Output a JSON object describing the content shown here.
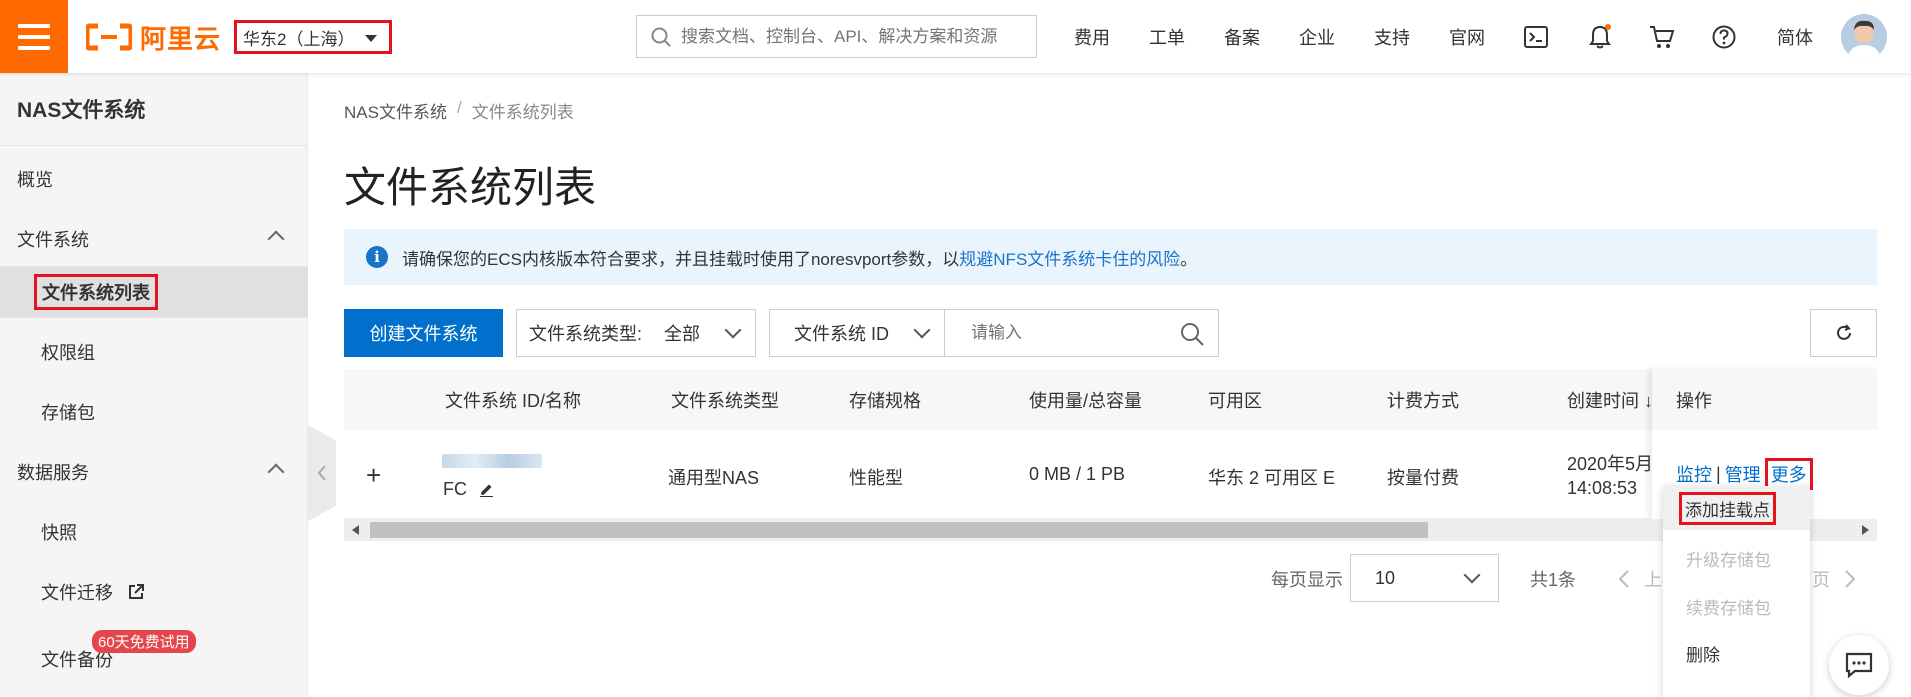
{
  "header": {
    "logo_text": "阿里云",
    "region": "华东2（上海）",
    "search_placeholder": "搜索文档、控制台、API、解决方案和资源",
    "nav": [
      "费用",
      "工单",
      "备案",
      "企业",
      "支持",
      "官网"
    ],
    "lang": "简体",
    "accent_color": "#ff6a00"
  },
  "sidebar": {
    "title": "NAS文件系统",
    "items": [
      {
        "label": "概览"
      },
      {
        "label": "文件系统"
      },
      {
        "label": "文件系统列表"
      },
      {
        "label": "权限组"
      },
      {
        "label": "存储包"
      },
      {
        "label": "数据服务"
      },
      {
        "label": "快照"
      },
      {
        "label": "文件迁移"
      },
      {
        "label": "文件备份"
      }
    ],
    "badge": "60天免费试用"
  },
  "breadcrumb": {
    "root": "NAS文件系统",
    "sep": "/",
    "current": "文件系统列表"
  },
  "page_title": "文件系统列表",
  "notice": {
    "text": "请确保您的ECS内核版本符合要求，并且挂载时使用了noresvport参数，以",
    "link": "规避NFS文件系统卡住的风险",
    "tail": "。"
  },
  "toolbar": {
    "create_label": "创建文件系统",
    "type_label": "文件系统类型:",
    "type_value": "全部",
    "id_label": "文件系统 ID",
    "search_placeholder": "请输入"
  },
  "table": {
    "headers": [
      "文件系统 ID/名称",
      "文件系统类型",
      "存储规格",
      "使用量/总容量",
      "可用区",
      "计费方式",
      "创建时间 ↓",
      "操作"
    ],
    "row": {
      "expand": "+",
      "name": "FC",
      "type": "通用型NAS",
      "spec": "性能型",
      "usage": "0 MB / 1 PB",
      "zone": "华东 2 可用区 E",
      "billing": "按量付费",
      "created_line1": "2020年5月",
      "created_line2": "14:08:53"
    },
    "actions": {
      "monitor": "监控",
      "sep": "|",
      "manage": "管理",
      "more": "更多"
    }
  },
  "dropdown": [
    "添加挂载点",
    "升级存储包",
    "续费存储包",
    "删除"
  ],
  "pagination": {
    "per_page_label": "每页显示",
    "per_page_value": "10",
    "total": "共1条",
    "prev": "上",
    "next_suffix": "页"
  }
}
